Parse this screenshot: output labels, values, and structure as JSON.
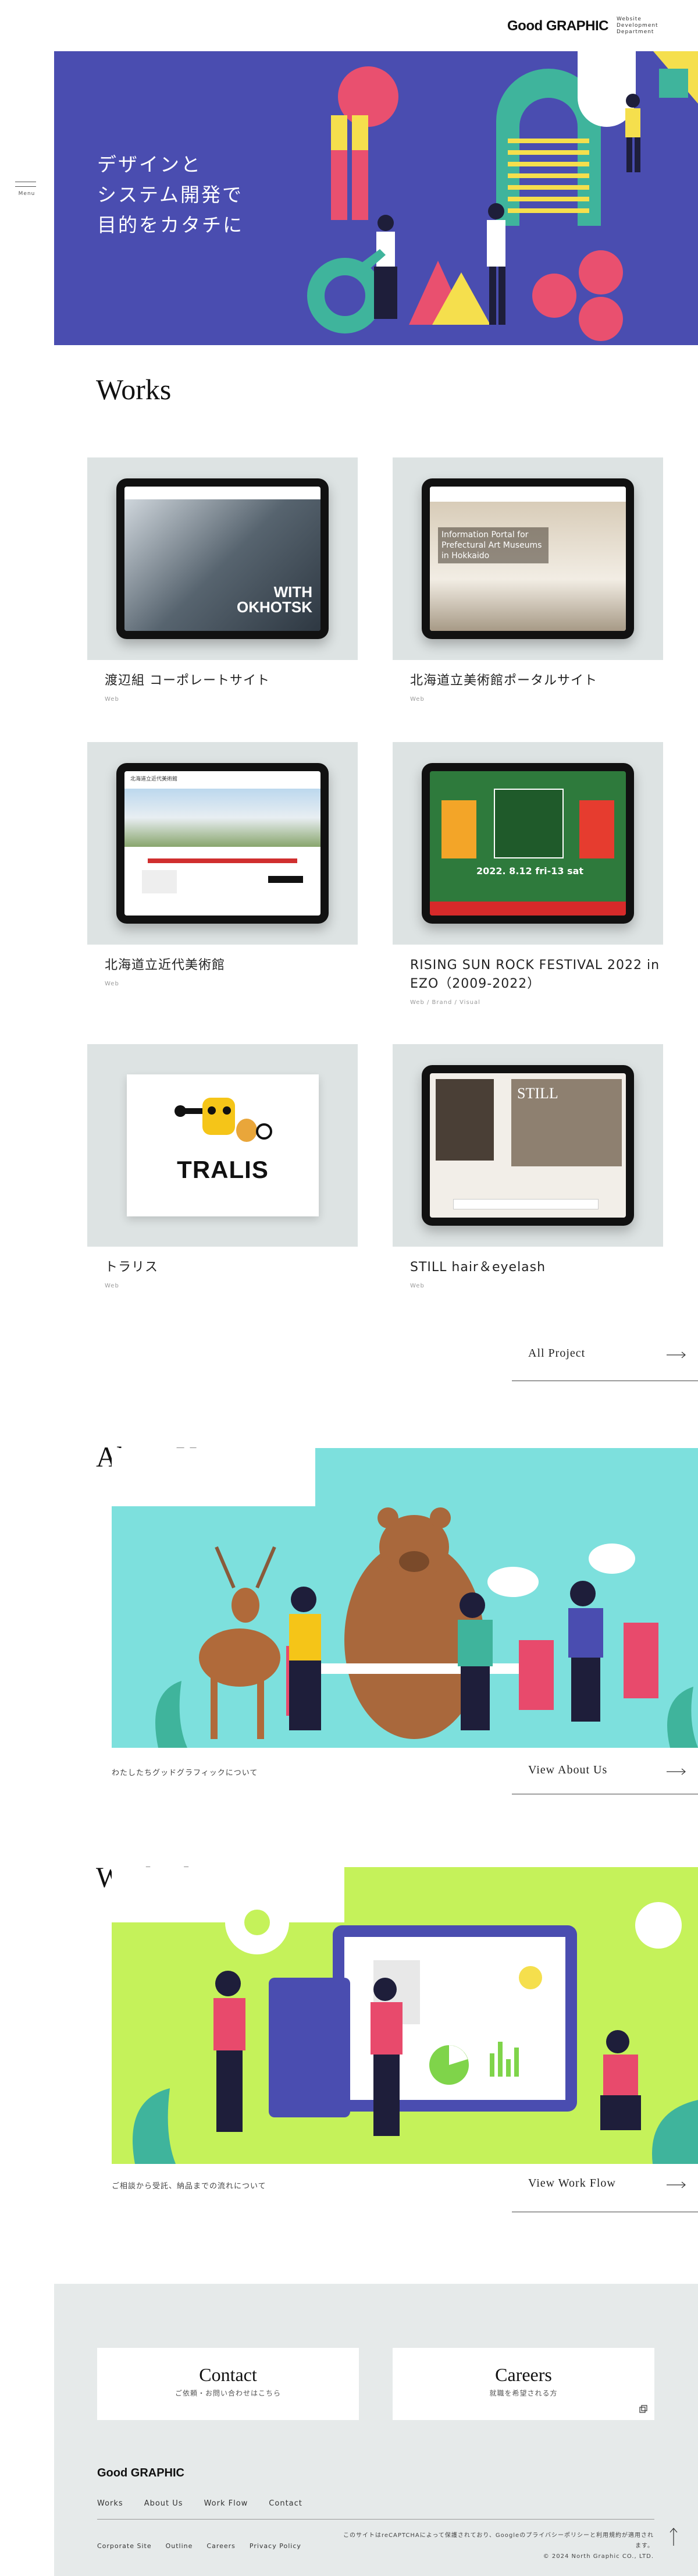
{
  "header": {
    "logo": "Good GRAPHIC",
    "logo_sub": "Website Development Department",
    "menu_label": "Menu"
  },
  "hero": {
    "copy_lines": [
      "デザインと",
      "システム開発で",
      "目的をカタチに"
    ]
  },
  "works": {
    "title": "Works",
    "items": [
      {
        "title": "渡辺組 コーポレートサイト",
        "category": "Web",
        "screen_text": "WITH OKHOTSK"
      },
      {
        "title": "北海道立美術館ポータルサイト",
        "category": "Web",
        "screen_text": "Information Portal for Prefectural Art Museums in Hokkaido"
      },
      {
        "title": "北海道立近代美術館",
        "category": "Web",
        "screen_text": "北海道立近代美術館"
      },
      {
        "title": "RISING SUN ROCK FESTIVAL 2022 in EZO（2009-2022）",
        "category": "Web / Brand / Visual",
        "screen_text": "2022. 8.12 fri-13 sat"
      },
      {
        "title": "トラリス",
        "category": "Web",
        "screen_text": "TRALIS"
      },
      {
        "title": "STILL hair＆eyelash",
        "category": "Web",
        "screen_text": "STILL"
      }
    ],
    "all_link": "All Project"
  },
  "about": {
    "title": "About Us",
    "caption": "わたしたちグッドグラフィックについて",
    "link": "View About Us"
  },
  "workflow": {
    "title": "Work Flow",
    "caption": "ご相談から受託、納品までの流れについて",
    "link": "View Work Flow"
  },
  "footer": {
    "contact": {
      "title": "Contact",
      "sub": "ご依頼・お問い合わせはこちら"
    },
    "careers": {
      "title": "Careers",
      "sub": "就職を希望される方"
    },
    "logo": "Good GRAPHIC",
    "nav": [
      "Works",
      "About Us",
      "Work Flow",
      "Contact"
    ],
    "subnav": [
      "Corporate Site",
      "Outline",
      "Careers",
      "Privacy Policy"
    ],
    "note": "このサイトはreCAPTCHAによって保護されており、Googleのプライバシーポリシーと利用規約が適用されます。",
    "copyright": "© 2024 North Graphic CO., LTD."
  },
  "colors": {
    "hero_bg": "#4a4db0",
    "pink": "#e9506f",
    "teal": "#3fb49c",
    "yellow": "#f5df4d",
    "about_bg": "#7de0dd",
    "flow_bg": "#c5f25a",
    "footer_bg": "#e6eaea"
  }
}
